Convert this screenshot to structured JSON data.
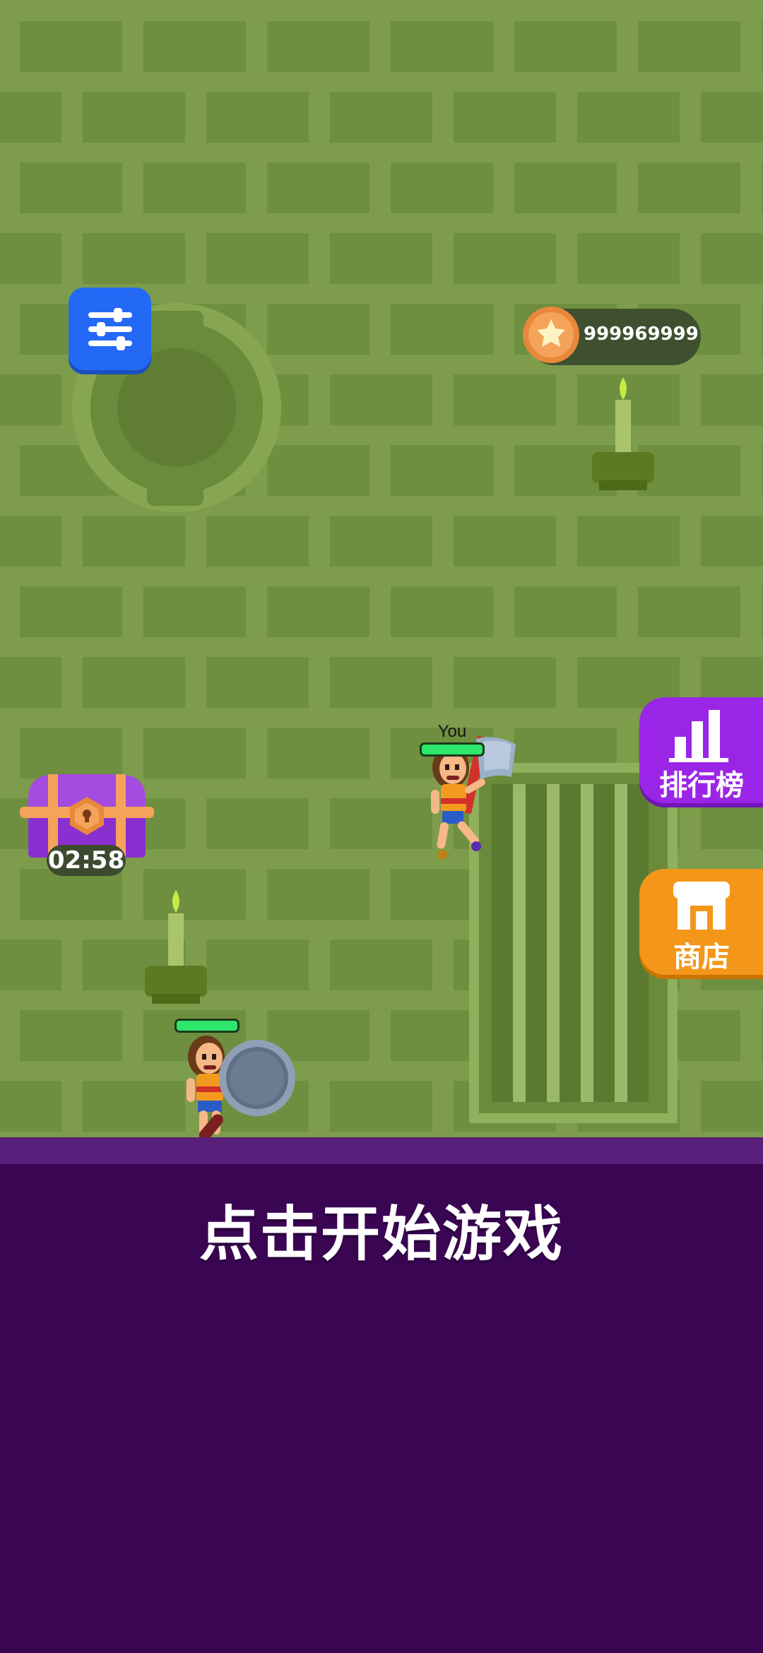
{
  "hud": {
    "settings_icon": "sliders-icon",
    "coins": "999969999",
    "coin_icon": "star-coin-icon"
  },
  "side_buttons": {
    "leaderboard_label": "排行榜",
    "leaderboard_icon": "bar-chart-icon",
    "shop_label": "商店",
    "shop_icon": "storefront-icon"
  },
  "chest": {
    "icon": "treasure-chest-icon",
    "timer": "02:58"
  },
  "player": {
    "label": "You"
  },
  "start_prompt": "点击开始游戏",
  "colors": {
    "wall": "#7d9c4c",
    "floor": "#3a0553",
    "settings": "#2469f5",
    "leaderboard": "#9b25e6",
    "shop": "#f39619"
  }
}
